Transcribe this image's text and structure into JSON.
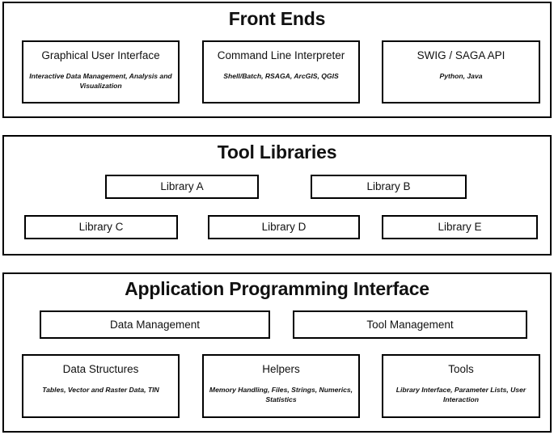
{
  "diagram": {
    "layers": [
      {
        "id": "front-ends",
        "title": "Front Ends",
        "boxes": [
          {
            "title": "Graphical User Interface",
            "subtitle": "Interactive Data Management, Analysis and Visualization"
          },
          {
            "title": "Command Line Interpreter",
            "subtitle": "Shell/Batch, RSAGA, ArcGIS, QGIS"
          },
          {
            "title": "SWIG / SAGA API",
            "subtitle": "Python, Java"
          }
        ]
      },
      {
        "id": "tool-libraries",
        "title": "Tool Libraries",
        "boxes": [
          {
            "title": "Library A",
            "subtitle": ""
          },
          {
            "title": "Library B",
            "subtitle": ""
          },
          {
            "title": "Library C",
            "subtitle": ""
          },
          {
            "title": "Library D",
            "subtitle": ""
          },
          {
            "title": "Library E",
            "subtitle": ""
          }
        ]
      },
      {
        "id": "application-programming-interface",
        "title": "Application Programming Interface",
        "boxes": [
          {
            "title": "Data Management",
            "subtitle": ""
          },
          {
            "title": "Tool Management",
            "subtitle": ""
          },
          {
            "title": "Data Structures",
            "subtitle": "Tables, Vector and Raster Data, TIN"
          },
          {
            "title": "Helpers",
            "subtitle": "Memory Handling, Files, Strings, Numerics, Statistics"
          },
          {
            "title": "Tools",
            "subtitle": "Library Interface, Parameter Lists, User Interaction"
          }
        ]
      }
    ],
    "colors": {
      "border": "#000000",
      "background": "#ffffff",
      "text": "#111111"
    }
  }
}
